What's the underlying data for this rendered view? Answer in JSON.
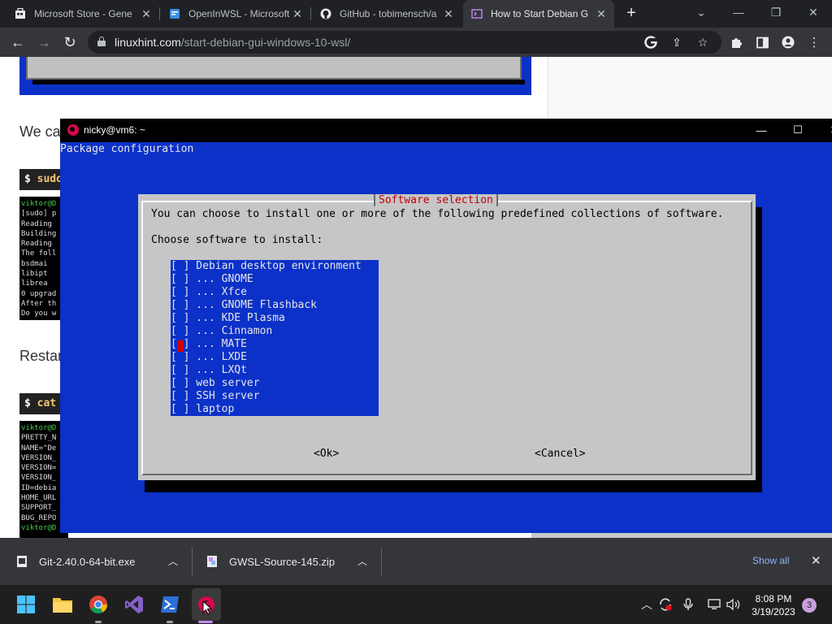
{
  "browser": {
    "tabs": [
      {
        "title": "Microsoft Store - Gene",
        "icon": "microsoft-store-icon"
      },
      {
        "title": "OpenInWSL - Microsoft",
        "icon": "openinwsl-icon"
      },
      {
        "title": "GitHub - tobimensch/a",
        "icon": "github-icon"
      },
      {
        "title": "How to Start Debian G",
        "icon": "linuxhint-icon",
        "active": true
      }
    ],
    "url_host": "linuxhint.com",
    "url_path": "/start-debian-gui-windows-10-wsl/"
  },
  "page": {
    "heading_1": "We ca",
    "heading_2": "Restar",
    "cmd_1": {
      "prompt": "$",
      "text": "sudo"
    },
    "cmd_2": {
      "prompt": "$",
      "text": "cat"
    },
    "term_out_1": [
      "viktor@D",
      "[sudo] p",
      "Reading",
      "Building",
      "Reading",
      "The foll",
      "  bsdmai",
      "  libipt",
      "  librea",
      "0 upgrad",
      "After th",
      "Do you w"
    ],
    "term_out_2": [
      "viktor@D",
      "PRETTY_N",
      "NAME=\"De",
      "VERSION_",
      "VERSION=",
      "VERSION_",
      "ID=debia",
      "HOME_URL",
      "SUPPORT_",
      "BUG_REPO",
      "viktor@D"
    ]
  },
  "terminal": {
    "title": "nicky@vm6: ~",
    "header": "Package configuration",
    "dialog": {
      "title": "Software selection",
      "description": "You can choose to install one or more of the following predefined collections of software.",
      "prompt": "Choose software to install:",
      "items": [
        "[ ] Debian desktop environment",
        "[ ] ... GNOME",
        "[ ] ... Xfce",
        "[ ] ... GNOME Flashback",
        "[ ] ... KDE Plasma",
        "[ ] ... Cinnamon",
        "[ ] ... MATE",
        "[ ] ... LXDE",
        "[ ] ... LXQt",
        "[ ] web server",
        "[ ] SSH server",
        "[ ] laptop"
      ],
      "ok_label": "<Ok>",
      "cancel_label": "<Cancel>"
    }
  },
  "downloads": {
    "items": [
      {
        "name": "Git-2.40.0-64-bit.exe"
      },
      {
        "name": "GWSL-Source-145.zip"
      }
    ],
    "show_all": "Show all"
  },
  "taskbar": {
    "time": "8:08 PM",
    "date": "3/19/2023",
    "notifications": "3"
  },
  "colors": {
    "terminal_blue": "#0b31c8",
    "dialog_gray": "#c6c6c6",
    "dialog_title_red": "#c40000",
    "debian_red": "#d70751"
  }
}
